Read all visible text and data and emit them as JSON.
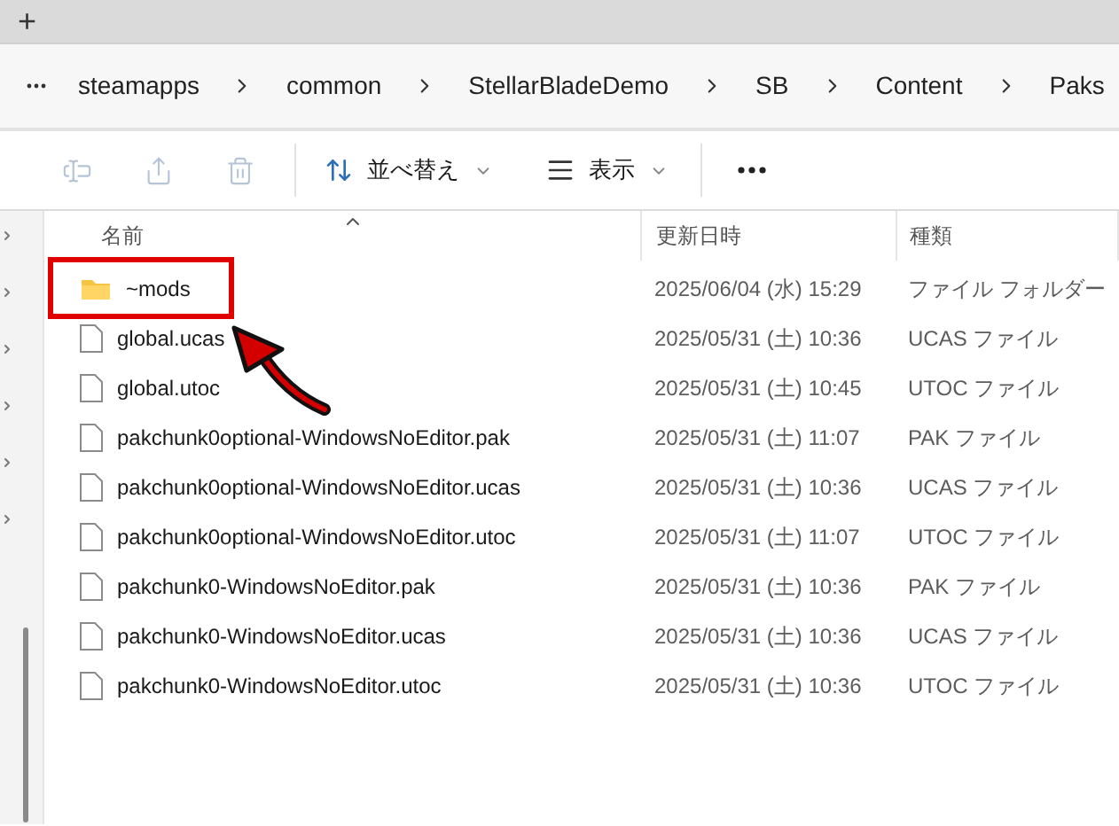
{
  "tab_bar": {
    "new_tab": "+"
  },
  "breadcrumb": [
    "steamapps",
    "common",
    "StellarBladeDemo",
    "SB",
    "Content",
    "Paks"
  ],
  "toolbar": {
    "icon_buttons": [
      {
        "kind": "rename",
        "disabled": true
      },
      {
        "kind": "share",
        "disabled": true
      },
      {
        "kind": "delete",
        "disabled": true
      }
    ],
    "sort": "並べ替え",
    "view": "表示"
  },
  "columns": [
    {
      "label": "名前",
      "sorted": true
    },
    {
      "label": "更新日時",
      "sorted": false
    },
    {
      "label": "種類",
      "sorted": false
    }
  ],
  "rows": [
    {
      "kind": "folder",
      "name": "~mods",
      "date": "2025/06/04 (水) 15:29",
      "type": "ファイル フォルダー",
      "annotated": true
    },
    {
      "kind": "file",
      "name": "global.ucas",
      "date": "2025/05/31 (土) 10:36",
      "type": "UCAS ファイル",
      "annotated": false
    },
    {
      "kind": "file",
      "name": "global.utoc",
      "date": "2025/05/31 (土) 10:45",
      "type": "UTOC ファイル",
      "annotated": false
    },
    {
      "kind": "file",
      "name": "pakchunk0optional-WindowsNoEditor.pak",
      "date": "2025/05/31 (土) 11:07",
      "type": "PAK ファイル",
      "annotated": false
    },
    {
      "kind": "file",
      "name": "pakchunk0optional-WindowsNoEditor.ucas",
      "date": "2025/05/31 (土) 10:36",
      "type": "UCAS ファイル",
      "annotated": false
    },
    {
      "kind": "file",
      "name": "pakchunk0optional-WindowsNoEditor.utoc",
      "date": "2025/05/31 (土) 11:07",
      "type": "UTOC ファイル",
      "annotated": false
    },
    {
      "kind": "file",
      "name": "pakchunk0-WindowsNoEditor.pak",
      "date": "2025/05/31 (土) 10:36",
      "type": "PAK ファイル",
      "annotated": false
    },
    {
      "kind": "file",
      "name": "pakchunk0-WindowsNoEditor.ucas",
      "date": "2025/05/31 (土) 10:36",
      "type": "UCAS ファイル",
      "annotated": false
    },
    {
      "kind": "file",
      "name": "pakchunk0-WindowsNoEditor.utoc",
      "date": "2025/05/31 (土) 10:36",
      "type": "UTOC ファイル",
      "annotated": false
    }
  ]
}
